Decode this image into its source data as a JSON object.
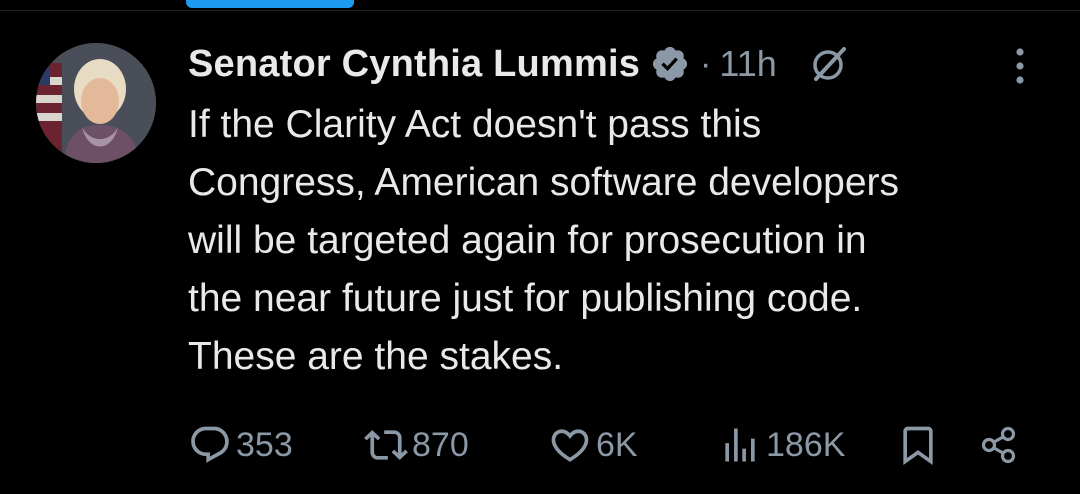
{
  "author": {
    "name": "Senator Cynthia Lummis",
    "verified": true
  },
  "post": {
    "separator": "·",
    "time": "11h",
    "text": "If the Clarity Act doesn't pass this\nCongress, American software developers\nwill be targeted again for prosecution in\nthe near future just for publishing code.\nThese are the stakes."
  },
  "actions": {
    "replies": "353",
    "reposts": "870",
    "likes": "6K",
    "views": "186K"
  },
  "icons": {
    "verified": "verified-badge-icon",
    "grok": "grok-icon",
    "more": "more-vertical-icon",
    "reply": "reply-icon",
    "repost": "repost-icon",
    "like": "heart-icon",
    "views": "views-icon",
    "bookmark": "bookmark-icon",
    "share": "share-icon"
  },
  "colors": {
    "background": "#000000",
    "text": "#e7e9ea",
    "muted": "#8b98a5",
    "accent": "#1d9bf0"
  }
}
